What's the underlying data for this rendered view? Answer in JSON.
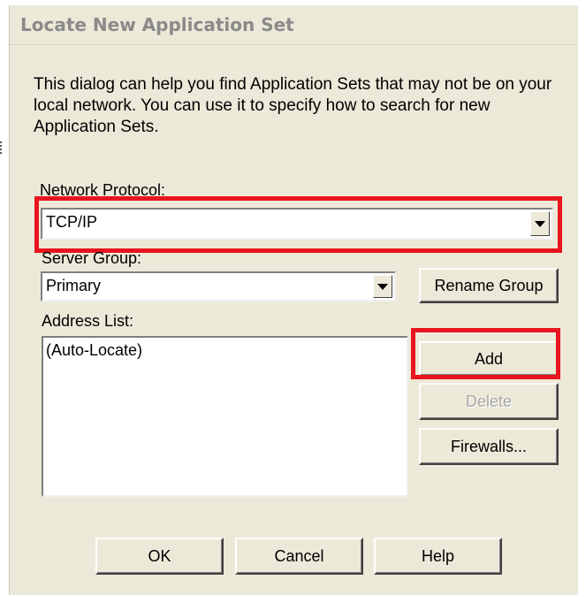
{
  "dialog": {
    "title": "Locate New Application Set",
    "description": "This dialog can help you find Application Sets that may not be on your local network.  You can use it to specify how to search for new Application Sets."
  },
  "network_protocol": {
    "label": "Network Protocol:",
    "value": "TCP/IP"
  },
  "server_group": {
    "label": "Server Group:",
    "value": "Primary",
    "rename_label": "Rename Group"
  },
  "address_list": {
    "label": "Address List:",
    "items": [
      "(Auto-Locate)"
    ]
  },
  "buttons": {
    "add": "Add",
    "delete": "Delete",
    "firewalls": "Firewalls...",
    "ok": "OK",
    "cancel": "Cancel",
    "help": "Help"
  },
  "colors": {
    "highlight": "#e8141e",
    "dialog_bg": "#ece9d8"
  },
  "icons": {
    "dropdown": "chevron-down-icon"
  }
}
